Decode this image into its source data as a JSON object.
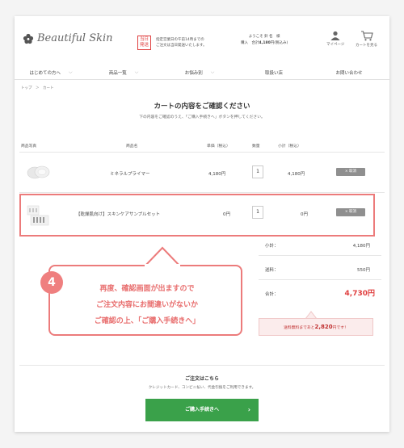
{
  "header": {
    "logo_text": "Beautiful Skin",
    "badge_line1": "当日",
    "badge_line2": "発送",
    "sameday_line1": "指定営業日の午前14時までの",
    "sameday_line2": "ご注文は当日発送いたします。",
    "welcome_line1": "ようこそ 鈴 名　様",
    "welcome_prefix": "購入",
    "welcome_amount": "4,180",
    "welcome_suffix": "円(税込み)",
    "mypage_label": "マイページ",
    "cart_label": "カートを見る"
  },
  "nav": {
    "items": [
      "はじめての方へ",
      "商品一覧",
      "お悩み別",
      "取扱い店",
      "お問い合わせ"
    ]
  },
  "breadcrumb": "トップ　＞　カート",
  "page": {
    "title": "カートの内容をご確認ください",
    "subtitle": "下の内容をご確認のうえ、「ご購入手続きへ」ボタンを押してください。"
  },
  "table": {
    "headers": [
      "商品写真",
      "商品名",
      "単価（税込）",
      "数量",
      "小計（税込）"
    ],
    "rows": [
      {
        "name": "ミネラルプライマー",
        "price": "4,180円",
        "qty": "1",
        "subtotal": "4,180円",
        "delete_label": "× 取消"
      },
      {
        "name": "【乾燥肌向け】スキンケアサンプルセット",
        "price": "0円",
        "qty": "1",
        "subtotal": "0円",
        "delete_label": "× 取消"
      }
    ]
  },
  "summary": {
    "subtotal_label": "小計：",
    "subtotal_value": "4,180円",
    "shipping_label": "送料：",
    "shipping_value": "550円",
    "total_label": "合計：",
    "total_value": "4,730円",
    "free_ship_prefix": "送料無料まであと",
    "free_ship_amount": "2,820",
    "free_ship_suffix": "円です！"
  },
  "callout": {
    "step": "4",
    "line1": "再度、確認画面が出ますので",
    "line2": "ご注文内容にお間違いがないか",
    "line3": "ご確認の上、「ご購入手続きへ」"
  },
  "order": {
    "title": "ご注文はこちら",
    "subtitle": "クレジットカード、コンビニ払い、代金引換をご利用できます。",
    "button_label": "ご購入手続きへ",
    "button_arrow": "›"
  },
  "colors": {
    "accent": "#e04040",
    "highlight": "#ec7b7b",
    "proceed_green": "#3aa14a"
  }
}
